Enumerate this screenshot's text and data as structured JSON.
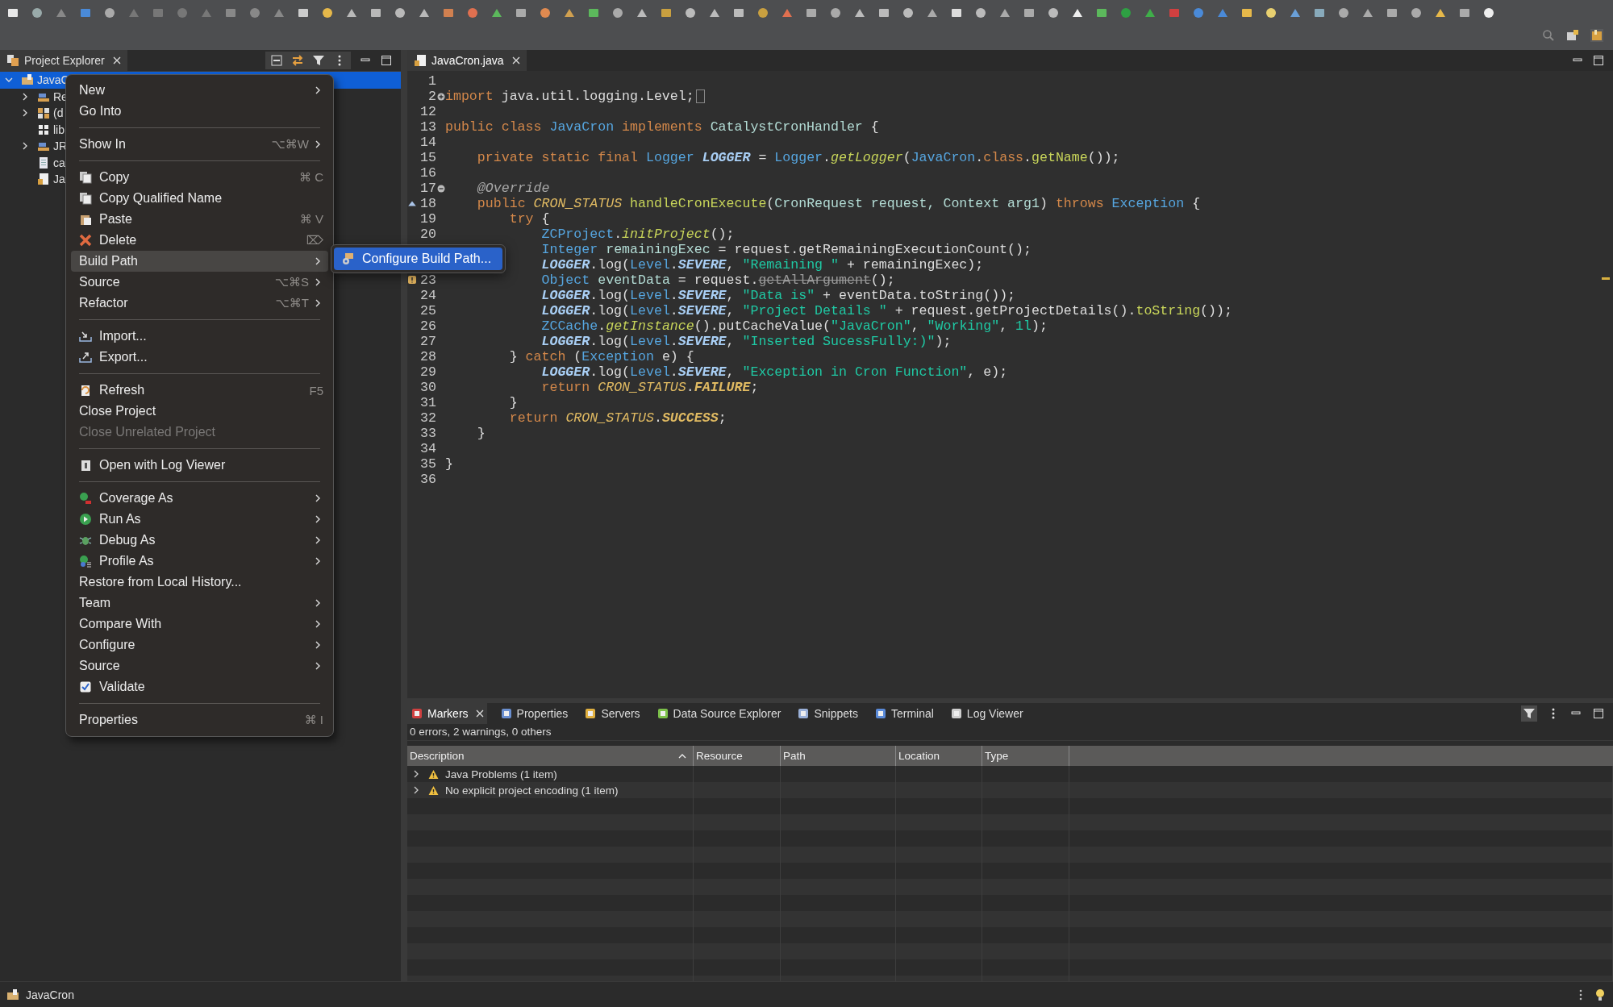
{
  "project_explorer": {
    "title": "Project Explorer",
    "tree": [
      {
        "label": "JavaC",
        "kind": "project",
        "selected": true,
        "expanded": true,
        "children": [
          {
            "label": "Re",
            "kind": "library",
            "selected": false,
            "expanded": false
          },
          {
            "label": "(d",
            "kind": "package",
            "selected": false,
            "expanded": false
          },
          {
            "label": "lib",
            "kind": "folder",
            "selected": false
          },
          {
            "label": "JR",
            "kind": "library",
            "selected": false,
            "expanded": false
          },
          {
            "label": "ca",
            "kind": "file",
            "selected": false
          },
          {
            "label": "Ja",
            "kind": "java",
            "selected": false
          }
        ]
      }
    ]
  },
  "context_menu": {
    "items": [
      {
        "kind": "item",
        "label": "New",
        "submenu": true,
        "selected": false,
        "disabled": false
      },
      {
        "kind": "item",
        "label": "Go Into",
        "selected": false,
        "disabled": false
      },
      {
        "kind": "separator"
      },
      {
        "kind": "item",
        "label": "Show In",
        "shortcut": "⌥⌘W",
        "submenu": true,
        "selected": false,
        "disabled": false
      },
      {
        "kind": "separator"
      },
      {
        "kind": "item",
        "label": "Copy",
        "shortcut": "⌘ C",
        "selected": false,
        "disabled": false
      },
      {
        "kind": "item",
        "label": "Copy Qualified Name",
        "selected": false,
        "disabled": false
      },
      {
        "kind": "item",
        "label": "Paste",
        "shortcut": "⌘ V",
        "selected": false,
        "disabled": false
      },
      {
        "kind": "item",
        "label": "Delete",
        "shortcut": "⌦",
        "selected": false,
        "disabled": false
      },
      {
        "kind": "item",
        "label": "Build Path",
        "submenu": true,
        "selected": true,
        "disabled": false
      },
      {
        "kind": "item",
        "label": "Source",
        "shortcut": "⌥⌘S",
        "submenu": true,
        "selected": false,
        "disabled": false
      },
      {
        "kind": "item",
        "label": "Refactor",
        "shortcut": "⌥⌘T",
        "submenu": true,
        "selected": false,
        "disabled": false
      },
      {
        "kind": "separator"
      },
      {
        "kind": "item",
        "label": "Import...",
        "selected": false,
        "disabled": false
      },
      {
        "kind": "item",
        "label": "Export...",
        "selected": false,
        "disabled": false
      },
      {
        "kind": "separator"
      },
      {
        "kind": "item",
        "label": "Refresh",
        "shortcut": "F5",
        "selected": false,
        "disabled": false
      },
      {
        "kind": "item",
        "label": "Close Project",
        "selected": false,
        "disabled": false
      },
      {
        "kind": "item",
        "label": "Close Unrelated Project",
        "selected": false,
        "disabled": true
      },
      {
        "kind": "separator"
      },
      {
        "kind": "item",
        "label": "Open with Log Viewer",
        "selected": false,
        "disabled": false
      },
      {
        "kind": "separator"
      },
      {
        "kind": "item",
        "label": "Coverage As",
        "submenu": true,
        "selected": false,
        "disabled": false
      },
      {
        "kind": "item",
        "label": "Run As",
        "submenu": true,
        "selected": false,
        "disabled": false
      },
      {
        "kind": "item",
        "label": "Debug As",
        "submenu": true,
        "selected": false,
        "disabled": false
      },
      {
        "kind": "item",
        "label": "Profile As",
        "submenu": true,
        "selected": false,
        "disabled": false
      },
      {
        "kind": "item",
        "label": "Restore from Local History...",
        "selected": false,
        "disabled": false
      },
      {
        "kind": "item",
        "label": "Team",
        "submenu": true,
        "selected": false,
        "disabled": false
      },
      {
        "kind": "item",
        "label": "Compare With",
        "submenu": true,
        "selected": false,
        "disabled": false
      },
      {
        "kind": "item",
        "label": "Configure",
        "submenu": true,
        "selected": false,
        "disabled": false
      },
      {
        "kind": "item",
        "label": "Source",
        "submenu": true,
        "selected": false,
        "disabled": false
      },
      {
        "kind": "check",
        "label": "Validate",
        "checked": true,
        "selected": false,
        "disabled": false
      },
      {
        "kind": "separator"
      },
      {
        "kind": "item",
        "label": "Properties",
        "shortcut": "⌘ I",
        "selected": false,
        "disabled": false
      }
    ]
  },
  "submenu": {
    "items": [
      {
        "label": "Configure Build Path...",
        "selected": true
      }
    ]
  },
  "editor": {
    "tab": {
      "label": "JavaCron.java",
      "selected": true
    },
    "lines": [
      {
        "number": "1"
      },
      {
        "number": "2",
        "folded": true,
        "tokens": [
          {
            "text": "import",
            "kind": "k"
          },
          {
            "text": " java.util.logging.Level;",
            "kind": "p"
          }
        ]
      },
      {
        "number": "12"
      },
      {
        "number": "13",
        "tokens": [
          {
            "text": "public class ",
            "kind": "k"
          },
          {
            "text": "JavaCron",
            "kind": "t"
          },
          {
            "text": " implements ",
            "kind": "k"
          },
          {
            "text": "CatalystCronHandler",
            "kind": "c"
          },
          {
            "text": " {",
            "kind": "p"
          }
        ]
      },
      {
        "number": "14"
      },
      {
        "number": "15",
        "tokens": [
          {
            "text": "    private static final ",
            "kind": "k"
          },
          {
            "text": "Logger ",
            "kind": "t"
          },
          {
            "text": "LOGGER",
            "kind": "f"
          },
          {
            "text": " = ",
            "kind": "p"
          },
          {
            "text": "Logger",
            "kind": "t"
          },
          {
            "text": ".",
            "kind": "p"
          },
          {
            "text": "getLogger",
            "kind": "m"
          },
          {
            "text": "(",
            "kind": "p"
          },
          {
            "text": "JavaCron",
            "kind": "t"
          },
          {
            "text": ".",
            "kind": "p"
          },
          {
            "text": "class",
            "kind": "k"
          },
          {
            "text": ".",
            "kind": "p"
          },
          {
            "text": "getName",
            "kind": "n"
          },
          {
            "text": "());",
            "kind": "p"
          }
        ]
      },
      {
        "number": "16"
      },
      {
        "number": "17",
        "folded": false,
        "tokens": [
          {
            "text": "    @Override",
            "kind": "a"
          }
        ]
      },
      {
        "number": "18",
        "override": true,
        "tokens": [
          {
            "text": "    public ",
            "kind": "k"
          },
          {
            "text": "CRON_STATUS",
            "kind": "e"
          },
          {
            "text": " handleCronExecute",
            "kind": "n"
          },
          {
            "text": "(",
            "kind": "p"
          },
          {
            "text": "CronRequest request, Context arg1",
            "kind": "c"
          },
          {
            "text": ")",
            "kind": "p"
          },
          {
            "text": " throws ",
            "kind": "k"
          },
          {
            "text": "Exception",
            "kind": "t"
          },
          {
            "text": " {",
            "kind": "p"
          }
        ]
      },
      {
        "number": "19",
        "tokens": [
          {
            "text": "        try",
            "kind": "k"
          },
          {
            "text": " {",
            "kind": "p"
          }
        ]
      },
      {
        "number": "20",
        "tokens": [
          {
            "text": "            ZCProject",
            "kind": "t"
          },
          {
            "text": ".",
            "kind": "p"
          },
          {
            "text": "initProject",
            "kind": "m"
          },
          {
            "text": "();",
            "kind": "p"
          }
        ]
      },
      {
        "tokens": [
          {
            "text": "            Integer ",
            "kind": "t"
          },
          {
            "text": "remainingExec",
            "kind": "c"
          },
          {
            "text": " = request.getRemainingExecutionCount();",
            "kind": "p"
          }
        ]
      },
      {
        "tokens": [
          {
            "text": "            LOGGER",
            "kind": "f"
          },
          {
            "text": ".log(",
            "kind": "p"
          },
          {
            "text": "Level",
            "kind": "t"
          },
          {
            "text": ".",
            "kind": "p"
          },
          {
            "text": "SEVERE",
            "kind": "f"
          },
          {
            "text": ", ",
            "kind": "p"
          },
          {
            "text": "\"Remaining \"",
            "kind": "s"
          },
          {
            "text": " + remainingExec);",
            "kind": "p"
          }
        ]
      },
      {
        "number": "23",
        "warning": true,
        "tokens": [
          {
            "text": "            Object ",
            "kind": "t"
          },
          {
            "text": "eventData",
            "kind": "c"
          },
          {
            "text": " = request.",
            "kind": "p"
          },
          {
            "text": "getAllArgument",
            "kind": "d"
          },
          {
            "text": "();",
            "kind": "p"
          }
        ]
      },
      {
        "number": "24",
        "tokens": [
          {
            "text": "            LOGGER",
            "kind": "f"
          },
          {
            "text": ".log(",
            "kind": "p"
          },
          {
            "text": "Level",
            "kind": "t"
          },
          {
            "text": ".",
            "kind": "p"
          },
          {
            "text": "SEVERE",
            "kind": "f"
          },
          {
            "text": ", ",
            "kind": "p"
          },
          {
            "text": "\"Data is\"",
            "kind": "s"
          },
          {
            "text": " + eventData.toString());",
            "kind": "p"
          }
        ]
      },
      {
        "number": "25",
        "tokens": [
          {
            "text": "            LOGGER",
            "kind": "f"
          },
          {
            "text": ".log(",
            "kind": "p"
          },
          {
            "text": "Level",
            "kind": "t"
          },
          {
            "text": ".",
            "kind": "p"
          },
          {
            "text": "SEVERE",
            "kind": "f"
          },
          {
            "text": ", ",
            "kind": "p"
          },
          {
            "text": "\"Project Details \"",
            "kind": "s"
          },
          {
            "text": " + request.getProjectDetails().",
            "kind": "p"
          },
          {
            "text": "toString",
            "kind": "n"
          },
          {
            "text": "());",
            "kind": "p"
          }
        ]
      },
      {
        "number": "26",
        "tokens": [
          {
            "text": "            ZCCache",
            "kind": "t"
          },
          {
            "text": ".",
            "kind": "p"
          },
          {
            "text": "getInstance",
            "kind": "m"
          },
          {
            "text": "().putCacheValue(",
            "kind": "p"
          },
          {
            "text": "\"JavaCron\"",
            "kind": "s"
          },
          {
            "text": ", ",
            "kind": "p"
          },
          {
            "text": "\"Working\"",
            "kind": "s"
          },
          {
            "text": ", ",
            "kind": "p"
          },
          {
            "text": "1l",
            "kind": "s"
          },
          {
            "text": ");",
            "kind": "p"
          }
        ]
      },
      {
        "number": "27",
        "tokens": [
          {
            "text": "            LOGGER",
            "kind": "f"
          },
          {
            "text": ".log(",
            "kind": "p"
          },
          {
            "text": "Level",
            "kind": "t"
          },
          {
            "text": ".",
            "kind": "p"
          },
          {
            "text": "SEVERE",
            "kind": "f"
          },
          {
            "text": ", ",
            "kind": "p"
          },
          {
            "text": "\"Inserted SucessFully:)\"",
            "kind": "s"
          },
          {
            "text": ");",
            "kind": "p"
          }
        ]
      },
      {
        "number": "28",
        "tokens": [
          {
            "text": "        } ",
            "kind": "p"
          },
          {
            "text": "catch",
            "kind": "k"
          },
          {
            "text": " (",
            "kind": "p"
          },
          {
            "text": "Exception",
            "kind": "t"
          },
          {
            "text": " e) {",
            "kind": "p"
          }
        ]
      },
      {
        "number": "29",
        "tokens": [
          {
            "text": "            LOGGER",
            "kind": "f"
          },
          {
            "text": ".log(",
            "kind": "p"
          },
          {
            "text": "Level",
            "kind": "t"
          },
          {
            "text": ".",
            "kind": "p"
          },
          {
            "text": "SEVERE",
            "kind": "f"
          },
          {
            "text": ", ",
            "kind": "p"
          },
          {
            "text": "\"Exception in Cron Function\"",
            "kind": "s"
          },
          {
            "text": ", e);",
            "kind": "p"
          }
        ]
      },
      {
        "number": "30",
        "tokens": [
          {
            "text": "            return ",
            "kind": "k"
          },
          {
            "text": "CRON_STATUS",
            "kind": "e"
          },
          {
            "text": ".",
            "kind": "p"
          },
          {
            "text": "FAILURE",
            "kind": "E"
          },
          {
            "text": ";",
            "kind": "p"
          }
        ]
      },
      {
        "number": "31",
        "tokens": [
          {
            "text": "        }",
            "kind": "p"
          }
        ]
      },
      {
        "number": "32",
        "tokens": [
          {
            "text": "        return ",
            "kind": "k"
          },
          {
            "text": "CRON_STATUS",
            "kind": "e"
          },
          {
            "text": ".",
            "kind": "p"
          },
          {
            "text": "SUCCESS",
            "kind": "E"
          },
          {
            "text": ";",
            "kind": "p"
          }
        ]
      },
      {
        "number": "33",
        "tokens": [
          {
            "text": "    }",
            "kind": "p"
          }
        ]
      },
      {
        "number": "34"
      },
      {
        "number": "35",
        "tokens": [
          {
            "text": "}",
            "kind": "p"
          }
        ]
      },
      {
        "number": "36"
      }
    ]
  },
  "bottom_panel": {
    "tabs": [
      {
        "label": "Markers",
        "kind": "markers",
        "selected": true
      },
      {
        "label": "Properties",
        "kind": "properties",
        "selected": false
      },
      {
        "label": "Servers",
        "kind": "servers",
        "selected": false
      },
      {
        "label": "Data Source Explorer",
        "kind": "datasource",
        "selected": false
      },
      {
        "label": "Snippets",
        "kind": "snippets",
        "selected": false
      },
      {
        "label": "Terminal",
        "kind": "terminal",
        "selected": false
      },
      {
        "label": "Log Viewer",
        "kind": "logviewer",
        "selected": false
      }
    ],
    "summary": "0 errors, 2 warnings, 0 others",
    "columns": [
      {
        "label": "Description",
        "sorted": true
      },
      {
        "label": "Resource",
        "sorted": false
      },
      {
        "label": "Path",
        "sorted": false
      },
      {
        "label": "Location",
        "sorted": false
      },
      {
        "label": "Type",
        "sorted": false
      }
    ],
    "rows": [
      {
        "description": "Java Problems (1 item)",
        "expanded": false
      },
      {
        "description": "No explicit project encoding (1 item)",
        "expanded": false
      }
    ]
  },
  "status_bar": {
    "label": "JavaCron"
  }
}
